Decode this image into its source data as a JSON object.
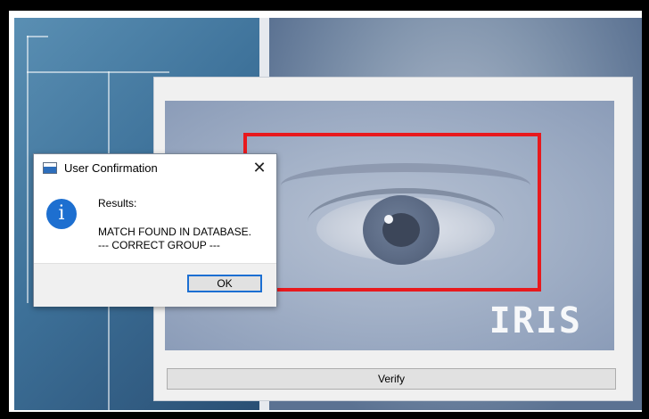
{
  "dialog": {
    "title": "User Confirmation",
    "close_glyph": "✕",
    "icon": "info-icon",
    "icon_glyph": "i",
    "heading": "Results:",
    "line1": "MATCH FOUND IN DATABASE.",
    "line2": "--- CORRECT GROUP ---",
    "ok_label": "OK"
  },
  "panel": {
    "image_overlay_text": "IRIS",
    "verify_label": "Verify"
  },
  "colors": {
    "detection_box": "#e8191d",
    "ok_focus": "#1c6fd2",
    "info_icon": "#1d6fd0"
  }
}
